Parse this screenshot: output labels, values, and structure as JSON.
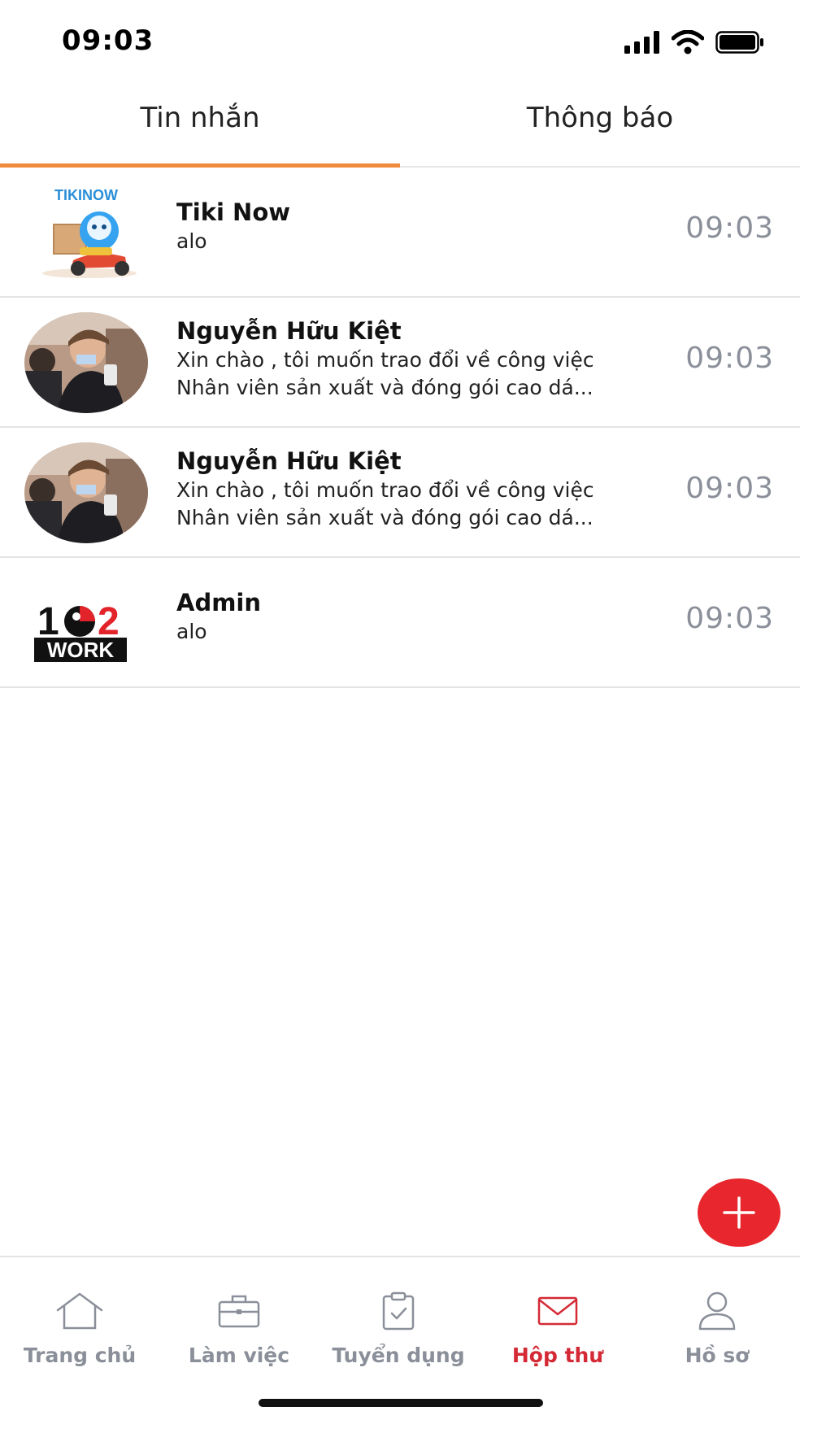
{
  "status_bar": {
    "time": "09:03"
  },
  "tabs": [
    {
      "label": "Tin nhắn",
      "active": true
    },
    {
      "label": "Thông báo",
      "active": false
    }
  ],
  "chats": [
    {
      "name": "Tiki Now",
      "lines": [
        "alo"
      ],
      "time": "09:03",
      "avatar": "tikinow-logo"
    },
    {
      "name": "Nguyễn Hữu Kiệt",
      "lines": [
        "Xin chào , tôi muốn trao đổi về công việc",
        "Nhân viên sản xuất và đóng gói cao dá..."
      ],
      "time": "09:03",
      "avatar": "user-photo"
    },
    {
      "name": "Nguyễn Hữu Kiệt",
      "lines": [
        "Xin chào , tôi muốn trao đổi về công việc",
        "Nhân viên sản xuất và đóng gói cao dá..."
      ],
      "time": "09:03",
      "avatar": "user-photo"
    },
    {
      "name": "Admin",
      "lines": [
        "alo"
      ],
      "time": "09:03",
      "avatar": "102work-logo"
    }
  ],
  "logos": {
    "tikinow": "TIKINOW",
    "work_top": "1",
    "work_2": "2",
    "work_bottom": "WORK"
  },
  "fab": {
    "icon": "plus-icon"
  },
  "bottom_nav": [
    {
      "label": "Trang chủ",
      "icon": "home-icon",
      "active": false
    },
    {
      "label": "Làm việc",
      "icon": "briefcase-icon",
      "active": false
    },
    {
      "label": "Tuyển dụng",
      "icon": "clipboard-check-icon",
      "active": false
    },
    {
      "label": "Hộp thư",
      "icon": "mail-icon",
      "active": true
    },
    {
      "label": "Hồ sơ",
      "icon": "person-icon",
      "active": false
    }
  ],
  "colors": {
    "accent": "#f08a3c",
    "active_nav": "#d42a36",
    "fab": "#e8262d",
    "muted": "#8a8f99"
  }
}
